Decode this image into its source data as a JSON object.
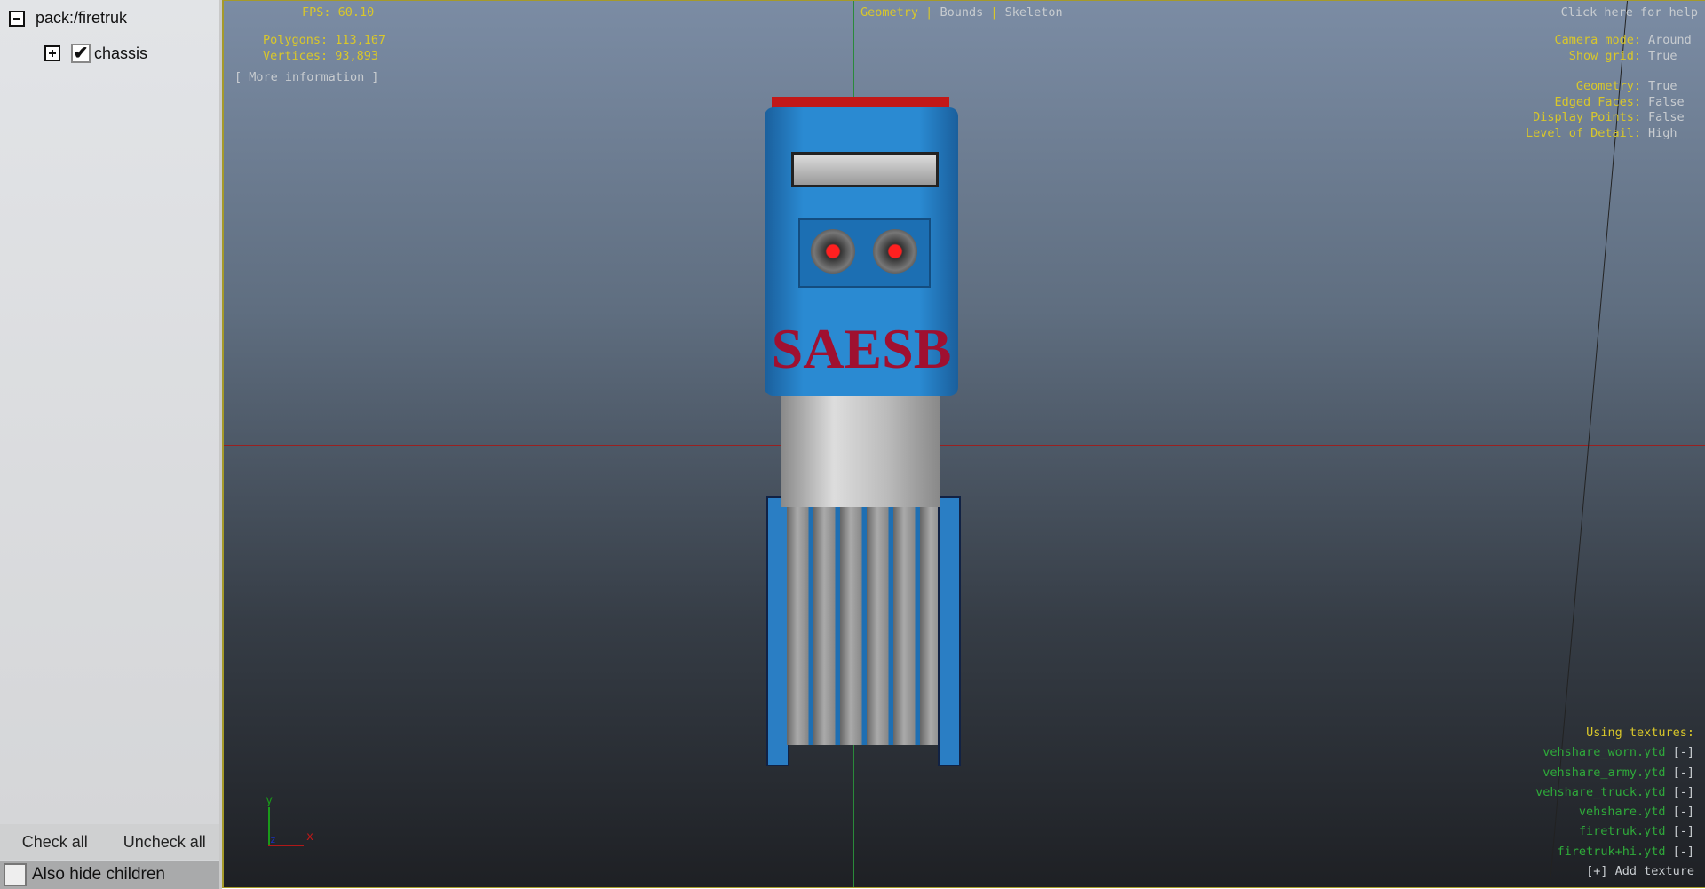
{
  "sidebar": {
    "tree": {
      "root_label": "pack:/firetruk",
      "child_label": "chassis",
      "child_checked": true
    },
    "check_all_label": "Check all",
    "uncheck_all_label": "Uncheck all",
    "also_hide_children_label": "Also hide children",
    "also_hide_children_checked": false
  },
  "viewport": {
    "fps": "FPS: 60.10",
    "polygons_label": "Polygons:",
    "polygons_value": "113,167",
    "vertices_label": "Vertices:",
    "vertices_value": "93,893",
    "more_info": "[ More information ]",
    "modes": {
      "geometry": "Geometry",
      "sep": "|",
      "bounds": "Bounds",
      "skeleton": "Skeleton"
    },
    "help": "Click here for help",
    "settings": [
      {
        "label": "Camera mode:",
        "value": "Around"
      },
      {
        "label": "Show grid:",
        "value": "True"
      },
      {
        "label": "Geometry:",
        "value": "True"
      },
      {
        "label": "Edged Faces:",
        "value": "False"
      },
      {
        "label": "Display Points:",
        "value": "False"
      },
      {
        "label": "Level of Detail:",
        "value": "High"
      }
    ],
    "textures_title": "Using textures:",
    "textures": [
      "vehshare_worn.ytd",
      "vehshare_army.ytd",
      "vehshare_truck.ytd",
      "vehshare.ytd",
      "firetruk.ytd",
      "firetruk+hi.ytd"
    ],
    "remove_label": "[-]",
    "add_texture": "[+] Add texture",
    "axes": {
      "y": "y",
      "x": "x",
      "z": "z"
    },
    "model_logo": "SAESB"
  }
}
